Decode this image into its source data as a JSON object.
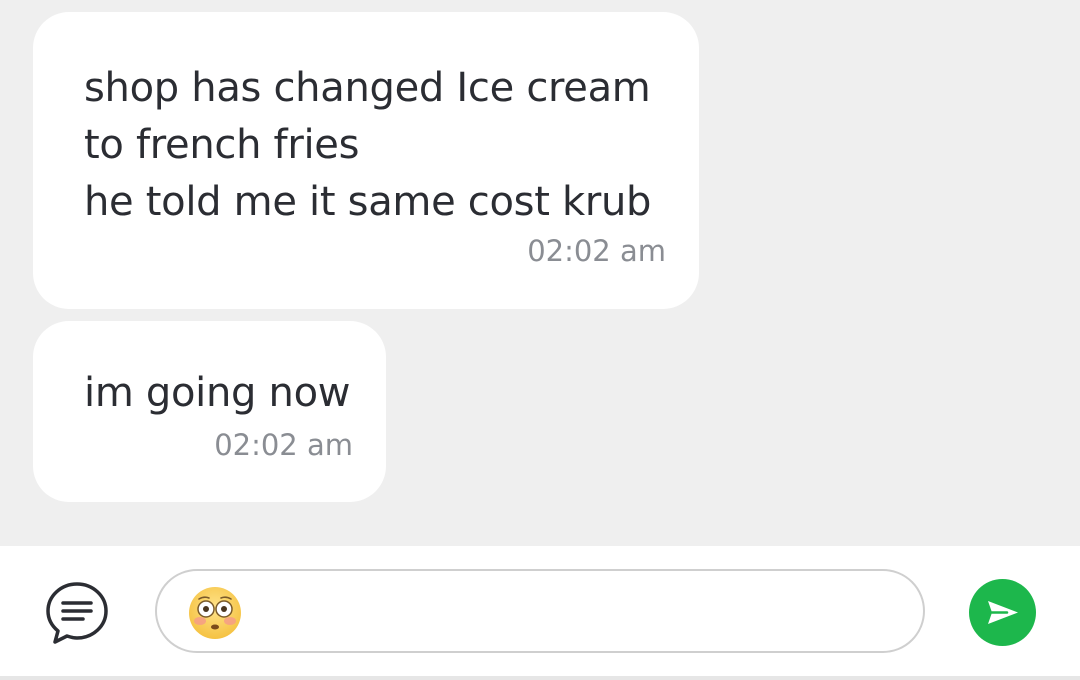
{
  "messages": [
    {
      "lines": [
        "shop has changed Ice cream",
        "to french fries",
        "he told me it same cost krub"
      ],
      "time": "02:02 am"
    },
    {
      "lines": [
        "im going now"
      ],
      "time": "02:02 am"
    }
  ],
  "composer": {
    "menu_icon": "message-menu-icon",
    "input_value_emoji": "flushed-face-emoji",
    "send_icon": "send-icon",
    "send_color": "#1db74c"
  }
}
